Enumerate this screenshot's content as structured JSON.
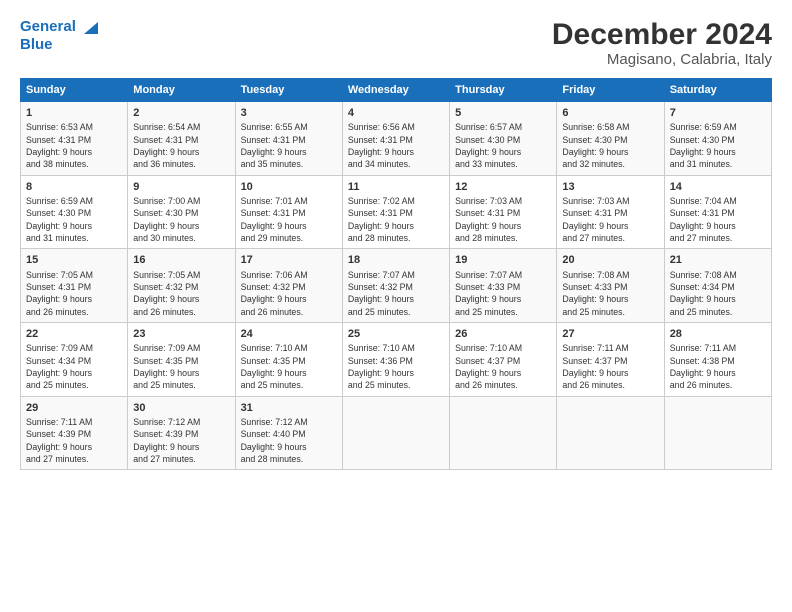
{
  "header": {
    "logo_line1": "General",
    "logo_line2": "Blue",
    "title": "December 2024",
    "subtitle": "Magisano, Calabria, Italy"
  },
  "columns": [
    "Sunday",
    "Monday",
    "Tuesday",
    "Wednesday",
    "Thursday",
    "Friday",
    "Saturday"
  ],
  "weeks": [
    [
      {
        "day": "1",
        "info": "Sunrise: 6:53 AM\nSunset: 4:31 PM\nDaylight: 9 hours\nand 38 minutes."
      },
      {
        "day": "2",
        "info": "Sunrise: 6:54 AM\nSunset: 4:31 PM\nDaylight: 9 hours\nand 36 minutes."
      },
      {
        "day": "3",
        "info": "Sunrise: 6:55 AM\nSunset: 4:31 PM\nDaylight: 9 hours\nand 35 minutes."
      },
      {
        "day": "4",
        "info": "Sunrise: 6:56 AM\nSunset: 4:31 PM\nDaylight: 9 hours\nand 34 minutes."
      },
      {
        "day": "5",
        "info": "Sunrise: 6:57 AM\nSunset: 4:30 PM\nDaylight: 9 hours\nand 33 minutes."
      },
      {
        "day": "6",
        "info": "Sunrise: 6:58 AM\nSunset: 4:30 PM\nDaylight: 9 hours\nand 32 minutes."
      },
      {
        "day": "7",
        "info": "Sunrise: 6:59 AM\nSunset: 4:30 PM\nDaylight: 9 hours\nand 31 minutes."
      }
    ],
    [
      {
        "day": "8",
        "info": "Sunrise: 6:59 AM\nSunset: 4:30 PM\nDaylight: 9 hours\nand 31 minutes."
      },
      {
        "day": "9",
        "info": "Sunrise: 7:00 AM\nSunset: 4:30 PM\nDaylight: 9 hours\nand 30 minutes."
      },
      {
        "day": "10",
        "info": "Sunrise: 7:01 AM\nSunset: 4:31 PM\nDaylight: 9 hours\nand 29 minutes."
      },
      {
        "day": "11",
        "info": "Sunrise: 7:02 AM\nSunset: 4:31 PM\nDaylight: 9 hours\nand 28 minutes."
      },
      {
        "day": "12",
        "info": "Sunrise: 7:03 AM\nSunset: 4:31 PM\nDaylight: 9 hours\nand 28 minutes."
      },
      {
        "day": "13",
        "info": "Sunrise: 7:03 AM\nSunset: 4:31 PM\nDaylight: 9 hours\nand 27 minutes."
      },
      {
        "day": "14",
        "info": "Sunrise: 7:04 AM\nSunset: 4:31 PM\nDaylight: 9 hours\nand 27 minutes."
      }
    ],
    [
      {
        "day": "15",
        "info": "Sunrise: 7:05 AM\nSunset: 4:31 PM\nDaylight: 9 hours\nand 26 minutes."
      },
      {
        "day": "16",
        "info": "Sunrise: 7:05 AM\nSunset: 4:32 PM\nDaylight: 9 hours\nand 26 minutes."
      },
      {
        "day": "17",
        "info": "Sunrise: 7:06 AM\nSunset: 4:32 PM\nDaylight: 9 hours\nand 26 minutes."
      },
      {
        "day": "18",
        "info": "Sunrise: 7:07 AM\nSunset: 4:32 PM\nDaylight: 9 hours\nand 25 minutes."
      },
      {
        "day": "19",
        "info": "Sunrise: 7:07 AM\nSunset: 4:33 PM\nDaylight: 9 hours\nand 25 minutes."
      },
      {
        "day": "20",
        "info": "Sunrise: 7:08 AM\nSunset: 4:33 PM\nDaylight: 9 hours\nand 25 minutes."
      },
      {
        "day": "21",
        "info": "Sunrise: 7:08 AM\nSunset: 4:34 PM\nDaylight: 9 hours\nand 25 minutes."
      }
    ],
    [
      {
        "day": "22",
        "info": "Sunrise: 7:09 AM\nSunset: 4:34 PM\nDaylight: 9 hours\nand 25 minutes."
      },
      {
        "day": "23",
        "info": "Sunrise: 7:09 AM\nSunset: 4:35 PM\nDaylight: 9 hours\nand 25 minutes."
      },
      {
        "day": "24",
        "info": "Sunrise: 7:10 AM\nSunset: 4:35 PM\nDaylight: 9 hours\nand 25 minutes."
      },
      {
        "day": "25",
        "info": "Sunrise: 7:10 AM\nSunset: 4:36 PM\nDaylight: 9 hours\nand 25 minutes."
      },
      {
        "day": "26",
        "info": "Sunrise: 7:10 AM\nSunset: 4:37 PM\nDaylight: 9 hours\nand 26 minutes."
      },
      {
        "day": "27",
        "info": "Sunrise: 7:11 AM\nSunset: 4:37 PM\nDaylight: 9 hours\nand 26 minutes."
      },
      {
        "day": "28",
        "info": "Sunrise: 7:11 AM\nSunset: 4:38 PM\nDaylight: 9 hours\nand 26 minutes."
      }
    ],
    [
      {
        "day": "29",
        "info": "Sunrise: 7:11 AM\nSunset: 4:39 PM\nDaylight: 9 hours\nand 27 minutes."
      },
      {
        "day": "30",
        "info": "Sunrise: 7:12 AM\nSunset: 4:39 PM\nDaylight: 9 hours\nand 27 minutes."
      },
      {
        "day": "31",
        "info": "Sunrise: 7:12 AM\nSunset: 4:40 PM\nDaylight: 9 hours\nand 28 minutes."
      },
      {
        "day": "",
        "info": ""
      },
      {
        "day": "",
        "info": ""
      },
      {
        "day": "",
        "info": ""
      },
      {
        "day": "",
        "info": ""
      }
    ]
  ]
}
